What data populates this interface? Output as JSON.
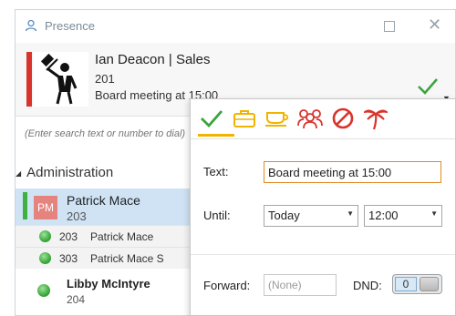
{
  "window": {
    "title": "Presence"
  },
  "user": {
    "name": "Ian Deacon | Sales",
    "ext": "201",
    "status_message": "Board meeting at 15:00",
    "status_color": "#d9342b"
  },
  "search": {
    "placeholder": "(Enter search text or number to dial)"
  },
  "group": {
    "name": "Administration"
  },
  "contacts": [
    {
      "initials": "PM",
      "name": "Patrick Mace",
      "ext": "203",
      "status_color": "#3fb13f",
      "devices": [
        {
          "number": "203",
          "name": "Patrick Mace"
        },
        {
          "number": "303",
          "name": "Patrick Mace S"
        }
      ]
    },
    {
      "name": "Libby McIntyre",
      "ext": "204",
      "status_color": "#3fb13f"
    }
  ],
  "popup": {
    "tabs": [
      "available-check-icon",
      "briefcase-icon",
      "coffee-cup-icon",
      "meeting-people-icon",
      "do-not-disturb-icon",
      "palm-tree-icon"
    ],
    "selected_tab_color": "#f0b400",
    "text_label": "Text:",
    "text_value": "Board meeting at 15:00",
    "until_label": "Until:",
    "until_day": "Today",
    "until_time": "12:00",
    "forward_label": "Forward:",
    "forward_value": "(None)",
    "dnd_label": "DND:",
    "dnd_value": "0"
  }
}
